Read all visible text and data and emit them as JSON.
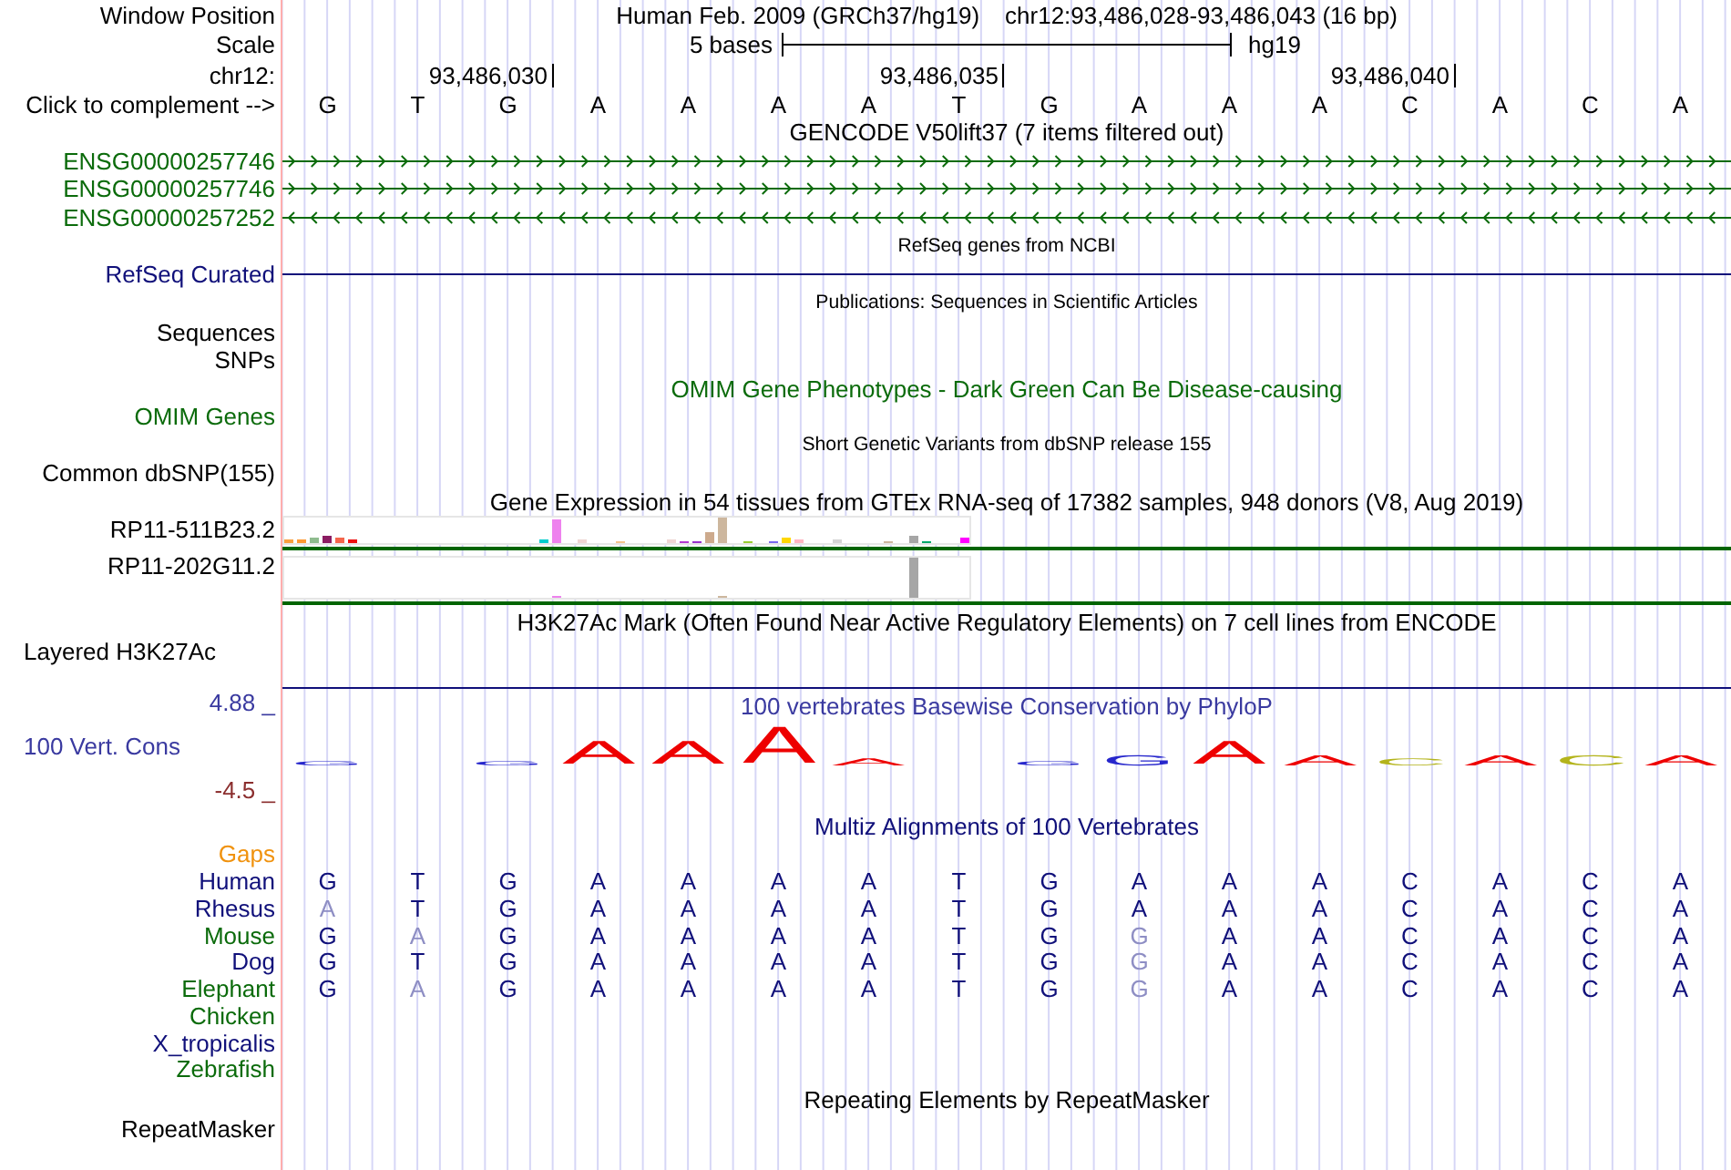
{
  "header": {
    "window_position": {
      "label": "Window Position",
      "assembly": "Human Feb. 2009 (GRCh37/hg19)",
      "position": "chr12:93,486,028-93,486,043 (16 bp)"
    },
    "scale": {
      "label": "Scale",
      "length": "5 bases",
      "assembly": "hg19"
    },
    "coordinates": {
      "label": "chr12:",
      "ticks": [
        "93,486,030",
        "93,486,035",
        "93,486,040"
      ]
    },
    "sequence": {
      "label": "Click to complement -->",
      "bases": [
        "G",
        "T",
        "G",
        "A",
        "A",
        "A",
        "A",
        "T",
        "G",
        "A",
        "A",
        "A",
        "C",
        "A",
        "C",
        "A"
      ]
    }
  },
  "tracks": [
    {
      "kind": "gene_models",
      "title": "GENCODE V50lift37 (7 items filtered out)",
      "genes": [
        {
          "label": "ENSG00000257746",
          "reverse": false
        },
        {
          "label": "ENSG00000257746",
          "reverse": false
        },
        {
          "label": "ENSG00000257252",
          "reverse": true
        }
      ]
    },
    {
      "kind": "refseq",
      "title": "RefSeq genes from NCBI",
      "label": "RefSeq Curated"
    },
    {
      "kind": "publications",
      "title": "Publications: Sequences in Scientific Articles",
      "labels": [
        "Sequences",
        "SNPs"
      ]
    },
    {
      "kind": "omim",
      "title": "OMIM Gene Phenotypes - Dark Green Can Be Disease-causing",
      "label": "OMIM Genes"
    },
    {
      "kind": "snps",
      "title": "Short Genetic Variants from dbSNP release 155",
      "label": "Common dbSNP(155)"
    },
    {
      "kind": "expression",
      "title": "Gene Expression in 54 tissues from GTEx RNA-seq of 17382 samples, 948 donors (V8, Aug 2019)",
      "genes": [
        "RP11-511B23.2",
        "RP11-202G11.2"
      ]
    },
    {
      "kind": "layered_signal",
      "title": "H3K27Ac Mark (Often Found Near Active Regulatory Elements) on 7 cell lines from ENCODE",
      "label": "Layered H3K27Ac"
    },
    {
      "kind": "conservation",
      "title": "100 vertebrates Basewise Conservation by PhyloP",
      "label": "100 Vert. Cons",
      "max_label": "4.88 _",
      "min_label": "-4.5 _",
      "logo": [
        {
          "letters": [
            {
              "letter": "G",
              "kind": "trace"
            }
          ]
        },
        {
          "letters": [
            {
              "letter": "G",
              "kind": "trace"
            },
            {
              "letter": "A",
              "kind": "high"
            },
            {
              "letter": "A",
              "kind": "high"
            },
            {
              "letter": "A",
              "kind": "peak"
            },
            {
              "letter": "A",
              "kind": "low"
            }
          ]
        },
        {
          "letters": [
            {
              "letter": "G",
              "kind": "trace"
            },
            {
              "letter": "G",
              "kind": "medium"
            },
            {
              "letter": "A",
              "kind": "high"
            },
            {
              "letter": "A",
              "kind": "medium"
            },
            {
              "letter": "C",
              "kind": "low"
            },
            {
              "letter": "A",
              "kind": "medium"
            },
            {
              "letter": "C",
              "kind": "medium"
            },
            {
              "letter": "A",
              "kind": "medium"
            }
          ]
        }
      ]
    },
    {
      "kind": "alignment",
      "title": "Multiz Alignments of 100 Vertebrates",
      "gaps_label": "Gaps",
      "species": [
        {
          "name": "Human",
          "color": "#10107a",
          "bases": [
            {
              "base": "G",
              "differs": false
            },
            {
              "base": "T",
              "differs": false
            },
            {
              "base": "G",
              "differs": false
            },
            {
              "base": "A",
              "differs": false
            },
            {
              "base": "A",
              "differs": false
            },
            {
              "base": "A",
              "differs": false
            },
            {
              "base": "A",
              "differs": false
            },
            {
              "base": "T",
              "differs": false
            },
            {
              "base": "G",
              "differs": false
            },
            {
              "base": "A",
              "differs": false
            },
            {
              "base": "A",
              "differs": false
            },
            {
              "base": "A",
              "differs": false
            },
            {
              "base": "C",
              "differs": false
            },
            {
              "base": "A",
              "differs": false
            },
            {
              "base": "C",
              "differs": false
            },
            {
              "base": "A",
              "differs": false
            }
          ]
        },
        {
          "name": "Rhesus",
          "color": "#10107a",
          "bases": [
            {
              "base": "A",
              "differs": true
            },
            {
              "base": "T",
              "differs": false
            },
            {
              "base": "G",
              "differs": false
            },
            {
              "base": "A",
              "differs": false
            },
            {
              "base": "A",
              "differs": false
            },
            {
              "base": "A",
              "differs": false
            },
            {
              "base": "A",
              "differs": false
            },
            {
              "base": "T",
              "differs": false
            },
            {
              "base": "G",
              "differs": false
            },
            {
              "base": "A",
              "differs": false
            },
            {
              "base": "A",
              "differs": false
            },
            {
              "base": "A",
              "differs": false
            },
            {
              "base": "C",
              "differs": false
            },
            {
              "base": "A",
              "differs": false
            },
            {
              "base": "C",
              "differs": false
            },
            {
              "base": "A",
              "differs": false
            }
          ]
        },
        {
          "name": "Mouse",
          "color": "#0b6b0b",
          "bases": [
            {
              "base": "G",
              "differs": false
            },
            {
              "base": "A",
              "differs": true
            },
            {
              "base": "G",
              "differs": false
            },
            {
              "base": "A",
              "differs": false
            },
            {
              "base": "A",
              "differs": false
            },
            {
              "base": "A",
              "differs": false
            },
            {
              "base": "A",
              "differs": false
            },
            {
              "base": "T",
              "differs": false
            },
            {
              "base": "G",
              "differs": false
            },
            {
              "base": "G",
              "differs": true
            },
            {
              "base": "A",
              "differs": false
            },
            {
              "base": "A",
              "differs": false
            },
            {
              "base": "C",
              "differs": false
            },
            {
              "base": "A",
              "differs": false
            },
            {
              "base": "C",
              "differs": false
            },
            {
              "base": "A",
              "differs": false
            }
          ]
        },
        {
          "name": "Dog",
          "color": "#10107a",
          "bases": [
            {
              "base": "G",
              "differs": false
            },
            {
              "base": "T",
              "differs": false
            },
            {
              "base": "G",
              "differs": false
            },
            {
              "base": "A",
              "differs": false
            },
            {
              "base": "A",
              "differs": false
            },
            {
              "base": "A",
              "differs": false
            },
            {
              "base": "A",
              "differs": false
            },
            {
              "base": "T",
              "differs": false
            },
            {
              "base": "G",
              "differs": false
            },
            {
              "base": "G",
              "differs": true
            },
            {
              "base": "A",
              "differs": false
            },
            {
              "base": "A",
              "differs": false
            },
            {
              "base": "C",
              "differs": false
            },
            {
              "base": "A",
              "differs": false
            },
            {
              "base": "C",
              "differs": false
            },
            {
              "base": "A",
              "differs": false
            }
          ]
        },
        {
          "name": "Elephant",
          "color": "#0b6b0b",
          "bases": [
            {
              "base": "G",
              "differs": false
            },
            {
              "base": "A",
              "differs": true
            },
            {
              "base": "G",
              "differs": false
            },
            {
              "base": "A",
              "differs": false
            },
            {
              "base": "A",
              "differs": false
            },
            {
              "base": "A",
              "differs": false
            },
            {
              "base": "A",
              "differs": false
            },
            {
              "base": "T",
              "differs": false
            },
            {
              "base": "G",
              "differs": false
            },
            {
              "base": "G",
              "differs": true
            },
            {
              "base": "A",
              "differs": false
            },
            {
              "base": "A",
              "differs": false
            },
            {
              "base": "C",
              "differs": false
            },
            {
              "base": "A",
              "differs": false
            },
            {
              "base": "C",
              "differs": false
            },
            {
              "base": "A",
              "differs": false
            }
          ]
        },
        {
          "name": "Chicken",
          "color": "#0b6b0b"
        },
        {
          "name": "X_tropicalis",
          "color": "#10107a"
        },
        {
          "name": "Zebrafish",
          "color": "#0b6b0b"
        }
      ]
    },
    {
      "kind": "repeats",
      "title": "Repeating Elements by RepeatMasker",
      "label": "RepeatMasker"
    }
  ]
}
